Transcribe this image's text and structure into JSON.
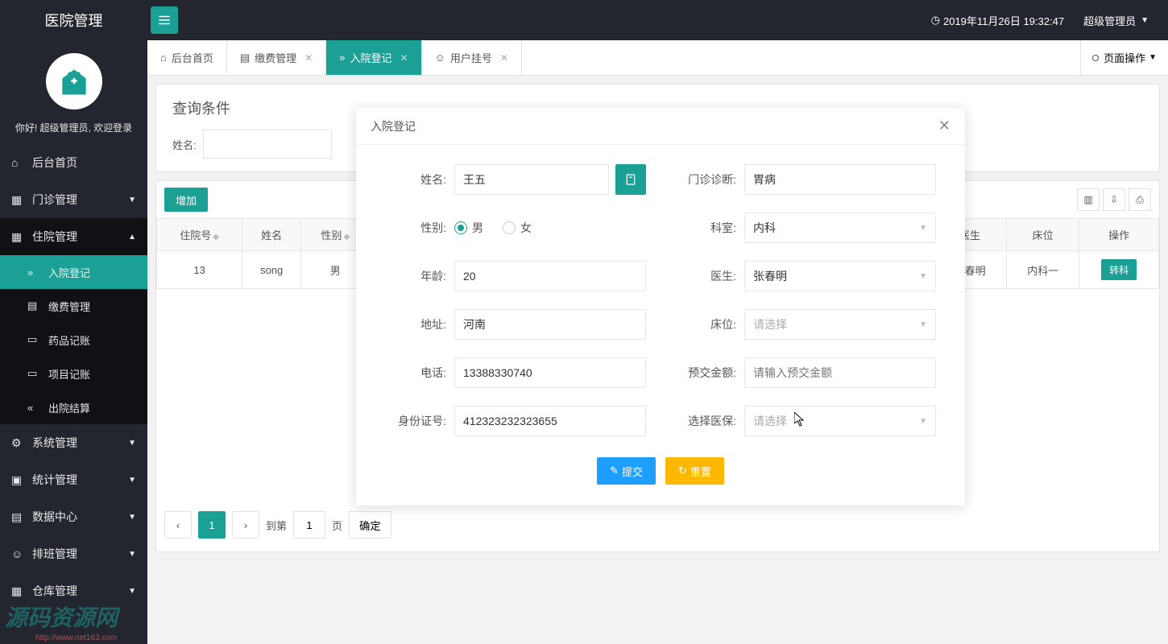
{
  "app_title": "医院管理",
  "header": {
    "time_text": "2019年11月26日 19:32:47",
    "user_label": "超级管理员"
  },
  "welcome": "你好! 超级管理员, 欢迎登录",
  "menu": [
    {
      "label": "后台首页",
      "icon": "home",
      "expandable": false
    },
    {
      "label": "门诊管理",
      "icon": "grid",
      "expandable": true
    },
    {
      "label": "住院管理",
      "icon": "grid",
      "expandable": true,
      "expanded": true,
      "children": [
        {
          "label": "入院登记",
          "icon": "double-right",
          "active": true
        },
        {
          "label": "缴费管理",
          "icon": "doc"
        },
        {
          "label": "药品记账",
          "icon": "book"
        },
        {
          "label": "项目记账",
          "icon": "book"
        },
        {
          "label": "出院结算",
          "icon": "double-left"
        }
      ]
    },
    {
      "label": "系统管理",
      "icon": "gear",
      "expandable": true
    },
    {
      "label": "统计管理",
      "icon": "monitor",
      "expandable": true
    },
    {
      "label": "数据中心",
      "icon": "file",
      "expandable": true
    },
    {
      "label": "排班管理",
      "icon": "person",
      "expandable": true
    },
    {
      "label": "仓库管理",
      "icon": "grid",
      "expandable": true
    }
  ],
  "tabs": [
    {
      "label": "后台首页",
      "icon": "home",
      "closable": false
    },
    {
      "label": "缴费管理",
      "icon": "doc",
      "closable": true
    },
    {
      "label": "入院登记",
      "icon": "double-right",
      "closable": true,
      "active": true
    },
    {
      "label": "用户挂号",
      "icon": "person",
      "closable": true
    }
  ],
  "page_ops_label": "页面操作",
  "search": {
    "title": "查询条件",
    "name_label": "姓名:"
  },
  "toolbar": {
    "add_label": "增加"
  },
  "columns": [
    "住院号",
    "姓名",
    "性别",
    "医生",
    "床位",
    "操作"
  ],
  "rows": [
    {
      "id": "13",
      "name": "song",
      "gender": "男",
      "doctor": "张春明",
      "bed": "内科一",
      "action": "转科"
    }
  ],
  "pagination": {
    "current": "1",
    "go_prefix": "到第",
    "go_suffix": "页",
    "go_value": "1",
    "confirm": "确定"
  },
  "modal": {
    "title": "入院登记",
    "labels": {
      "name": "姓名:",
      "diagnosis": "门诊诊断:",
      "gender": "性别:",
      "department": "科室:",
      "age": "年龄:",
      "doctor": "医生:",
      "address": "地址:",
      "bed": "床位:",
      "phone": "电话:",
      "prepay": "预交金额:",
      "idcard": "身份证号:",
      "insurance": "选择医保:"
    },
    "values": {
      "name": "王五",
      "diagnosis": "胃病",
      "age": "20",
      "department": "内科",
      "doctor": "张春明",
      "address": "河南",
      "phone": "13388330740",
      "idcard": "412323232323655"
    },
    "gender_options": {
      "male": "男",
      "female": "女",
      "selected": "male"
    },
    "placeholders": {
      "bed": "请选择",
      "prepay": "请输入预交金额",
      "insurance": "请选择"
    },
    "buttons": {
      "submit": "提交",
      "reset": "重置"
    }
  },
  "watermark": {
    "main": "源码资源网",
    "sub": "http://www.net163.com"
  }
}
